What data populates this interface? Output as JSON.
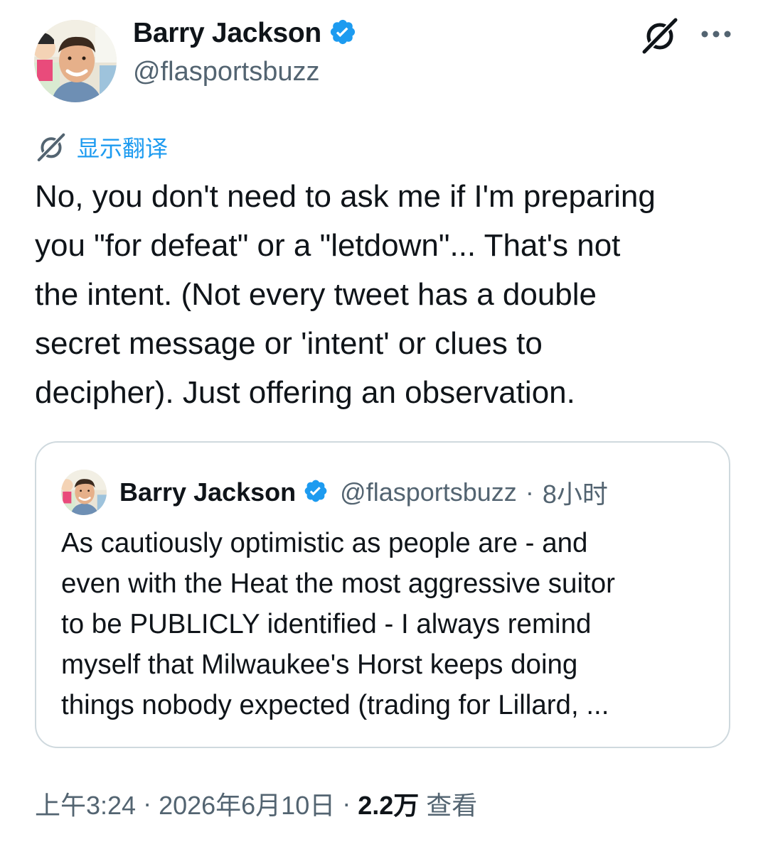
{
  "author": {
    "display_name": "Barry Jackson",
    "handle": "@flasportsbuzz",
    "verified": true
  },
  "actions": {
    "grok_icon": "grok-icon",
    "more_icon": "more-horizontal-icon"
  },
  "translate": {
    "label": "显示翻译"
  },
  "tweet": {
    "text": "No, you don't need to ask me if I'm preparing\nyou \"for defeat\" or a \"letdown\"... That's not\nthe intent. (Not every tweet has a double\nsecret message or 'intent' or clues to\ndecipher). Just offering an observation."
  },
  "quoted_tweet": {
    "display_name": "Barry Jackson",
    "handle": "@flasportsbuzz",
    "separator": "·",
    "time": "8小时",
    "text": "As cautiously optimistic as people are - and\neven with the Heat the most aggressive suitor\nto be PUBLICLY identified - I always remind\nmyself that Milwaukee's Horst keeps doing\nthings nobody expected (trading for Lillard, ..."
  },
  "footer": {
    "time": "上午3:24",
    "separator": "·",
    "date": "2026年6月10日",
    "views_count": "2.2万",
    "views_label": "查看"
  },
  "colors": {
    "accent": "#1d9bf0",
    "secondary_text": "#536471",
    "primary_text": "#0f1419",
    "border": "#cfd9de"
  }
}
